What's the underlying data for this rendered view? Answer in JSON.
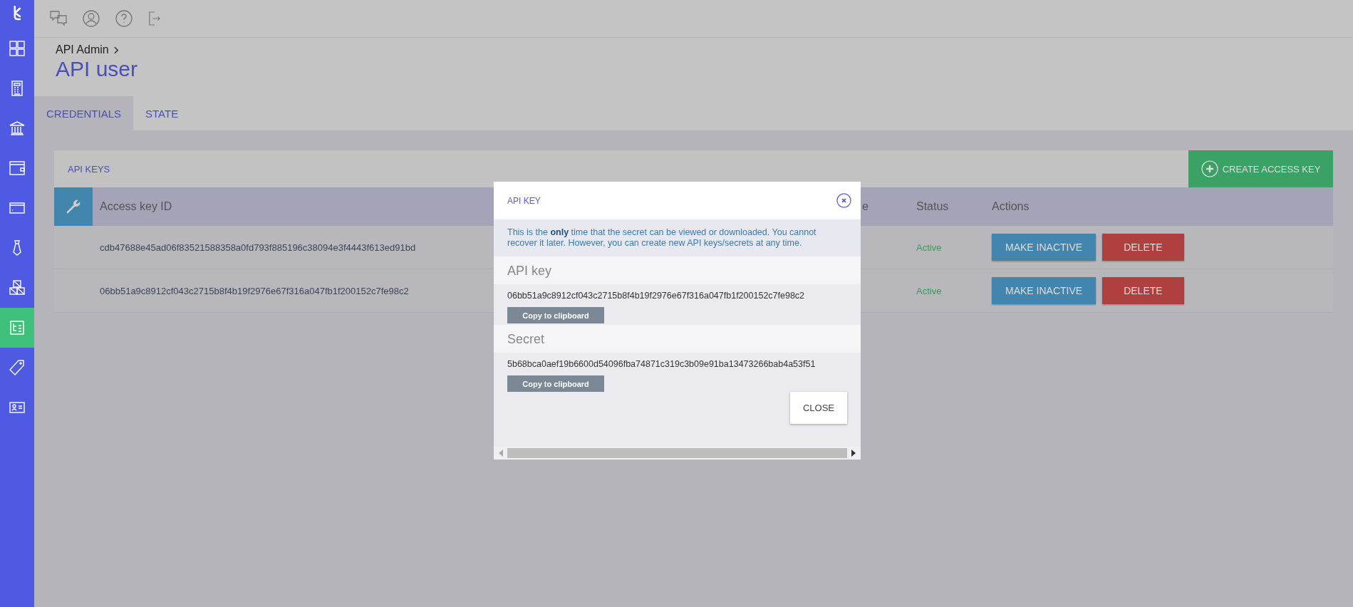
{
  "sidebar": {
    "items": [
      {
        "kind": "grid",
        "selected": false
      },
      {
        "kind": "calculator",
        "selected": false
      },
      {
        "kind": "bank",
        "selected": false
      },
      {
        "kind": "wallet",
        "selected": false
      },
      {
        "kind": "card",
        "selected": false
      },
      {
        "kind": "tie",
        "selected": false
      },
      {
        "kind": "boxes",
        "selected": false
      },
      {
        "kind": "diagram",
        "selected": true
      },
      {
        "kind": "tag",
        "selected": false
      },
      {
        "kind": "id-card",
        "selected": false
      }
    ]
  },
  "breadcrumb": "API Admin",
  "title": "API user",
  "tabs": [
    {
      "label": "CREDENTIALS",
      "selected": true
    },
    {
      "label": "STATE",
      "selected": false
    }
  ],
  "card": {
    "title": "API KEYS",
    "create_button": "CREATE ACCESS KEY",
    "columns": [
      "Access key ID",
      "e",
      "Status",
      "Actions"
    ],
    "rows": [
      {
        "access_key_id": "cdb47688e45ad06f83521588358a0fd793f885196c38094e3f4443f613ed91bd",
        "status": "Active",
        "actions": [
          "MAKE INACTIVE",
          "DELETE"
        ]
      },
      {
        "access_key_id": "06bb51a9c8912cf043c2715b8f4b19f2976e67f316a047fb1f200152c7fe98c2",
        "status": "Active",
        "actions": [
          "MAKE INACTIVE",
          "DELETE"
        ]
      }
    ]
  },
  "modal": {
    "title": "API KEY",
    "notice": "This is the **only** time that the secret can be viewed or downloaded. You cannot recover it later. However, you can create new API keys/secrets at any time.",
    "sections": [
      {
        "heading": "API key",
        "value": "06bb51a9c8912cf043c2715b8f4b19f2976e67f316a047fb1f200152c7fe98c2",
        "button": "Copy to clipboard"
      },
      {
        "heading": "Secret",
        "value": "5b68bca0aef19b6600d54096fba74871c319c3b09e91ba13473266bab4a53f51",
        "button": "Copy to clipboard"
      }
    ],
    "close_button": "CLOSE"
  }
}
